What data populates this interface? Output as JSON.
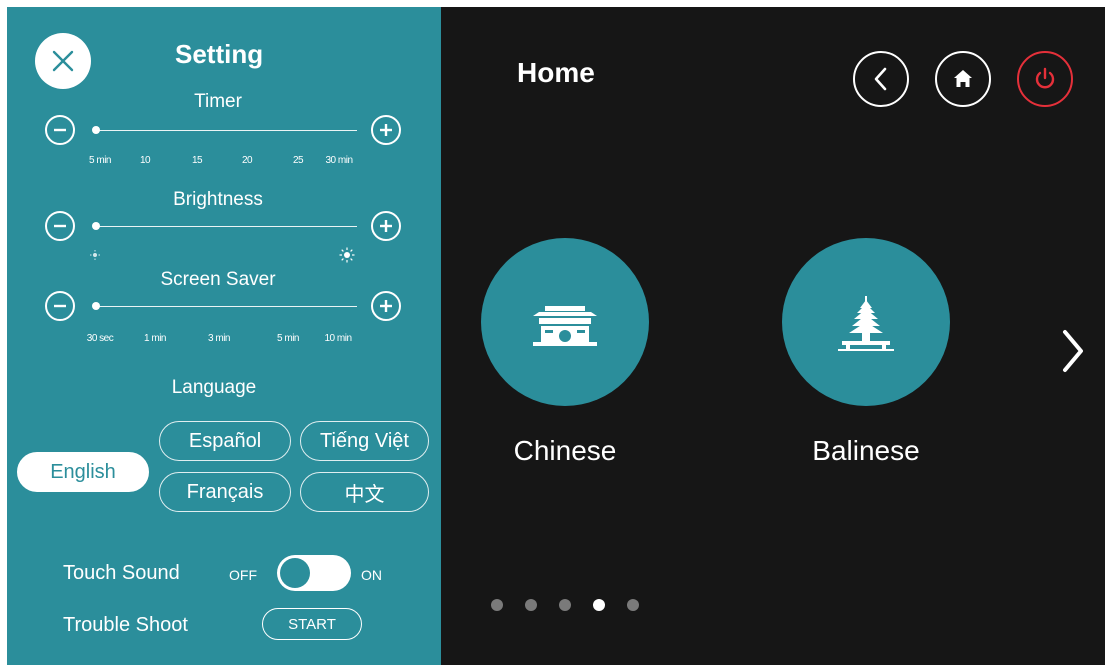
{
  "settings": {
    "title": "Setting",
    "timer": {
      "label": "Timer",
      "ticks": [
        "5 min",
        "10",
        "15",
        "20",
        "25",
        "30 min"
      ],
      "value": "5 min"
    },
    "brightness": {
      "label": "Brightness",
      "value_fraction": 0
    },
    "screen_saver": {
      "label": "Screen Saver",
      "ticks": [
        "30 sec",
        "1 min",
        "3 min",
        "5 min",
        "10 min"
      ],
      "value": "30 sec"
    },
    "language": {
      "label": "Language",
      "options": [
        "English",
        "Español",
        "Tiếng Việt",
        "Français",
        "中文"
      ],
      "selected": "English"
    },
    "touch_sound": {
      "label": "Touch Sound",
      "off_label": "OFF",
      "on_label": "ON",
      "state": "on"
    },
    "trouble_shoot": {
      "label": "Trouble Shoot",
      "button": "START"
    }
  },
  "home": {
    "title": "Home",
    "cuisines": [
      {
        "label": "Chinese",
        "icon": "chinese-gate-icon"
      },
      {
        "label": "Balinese",
        "icon": "balinese-pagoda-icon"
      }
    ],
    "page_count": 5,
    "current_page": 4
  },
  "colors": {
    "panel_teal": "#2b8e9b",
    "background_dark": "#161616",
    "power_red": "#e5303a",
    "dot_inactive": "#7a7a7a"
  },
  "icons": {
    "close": "close-icon",
    "minus": "minus-icon",
    "plus": "plus-icon",
    "back": "chevron-left-icon",
    "home": "home-icon",
    "power": "power-icon",
    "next": "chevron-right-icon",
    "moon": "low-brightness-icon",
    "sun": "high-brightness-icon"
  }
}
